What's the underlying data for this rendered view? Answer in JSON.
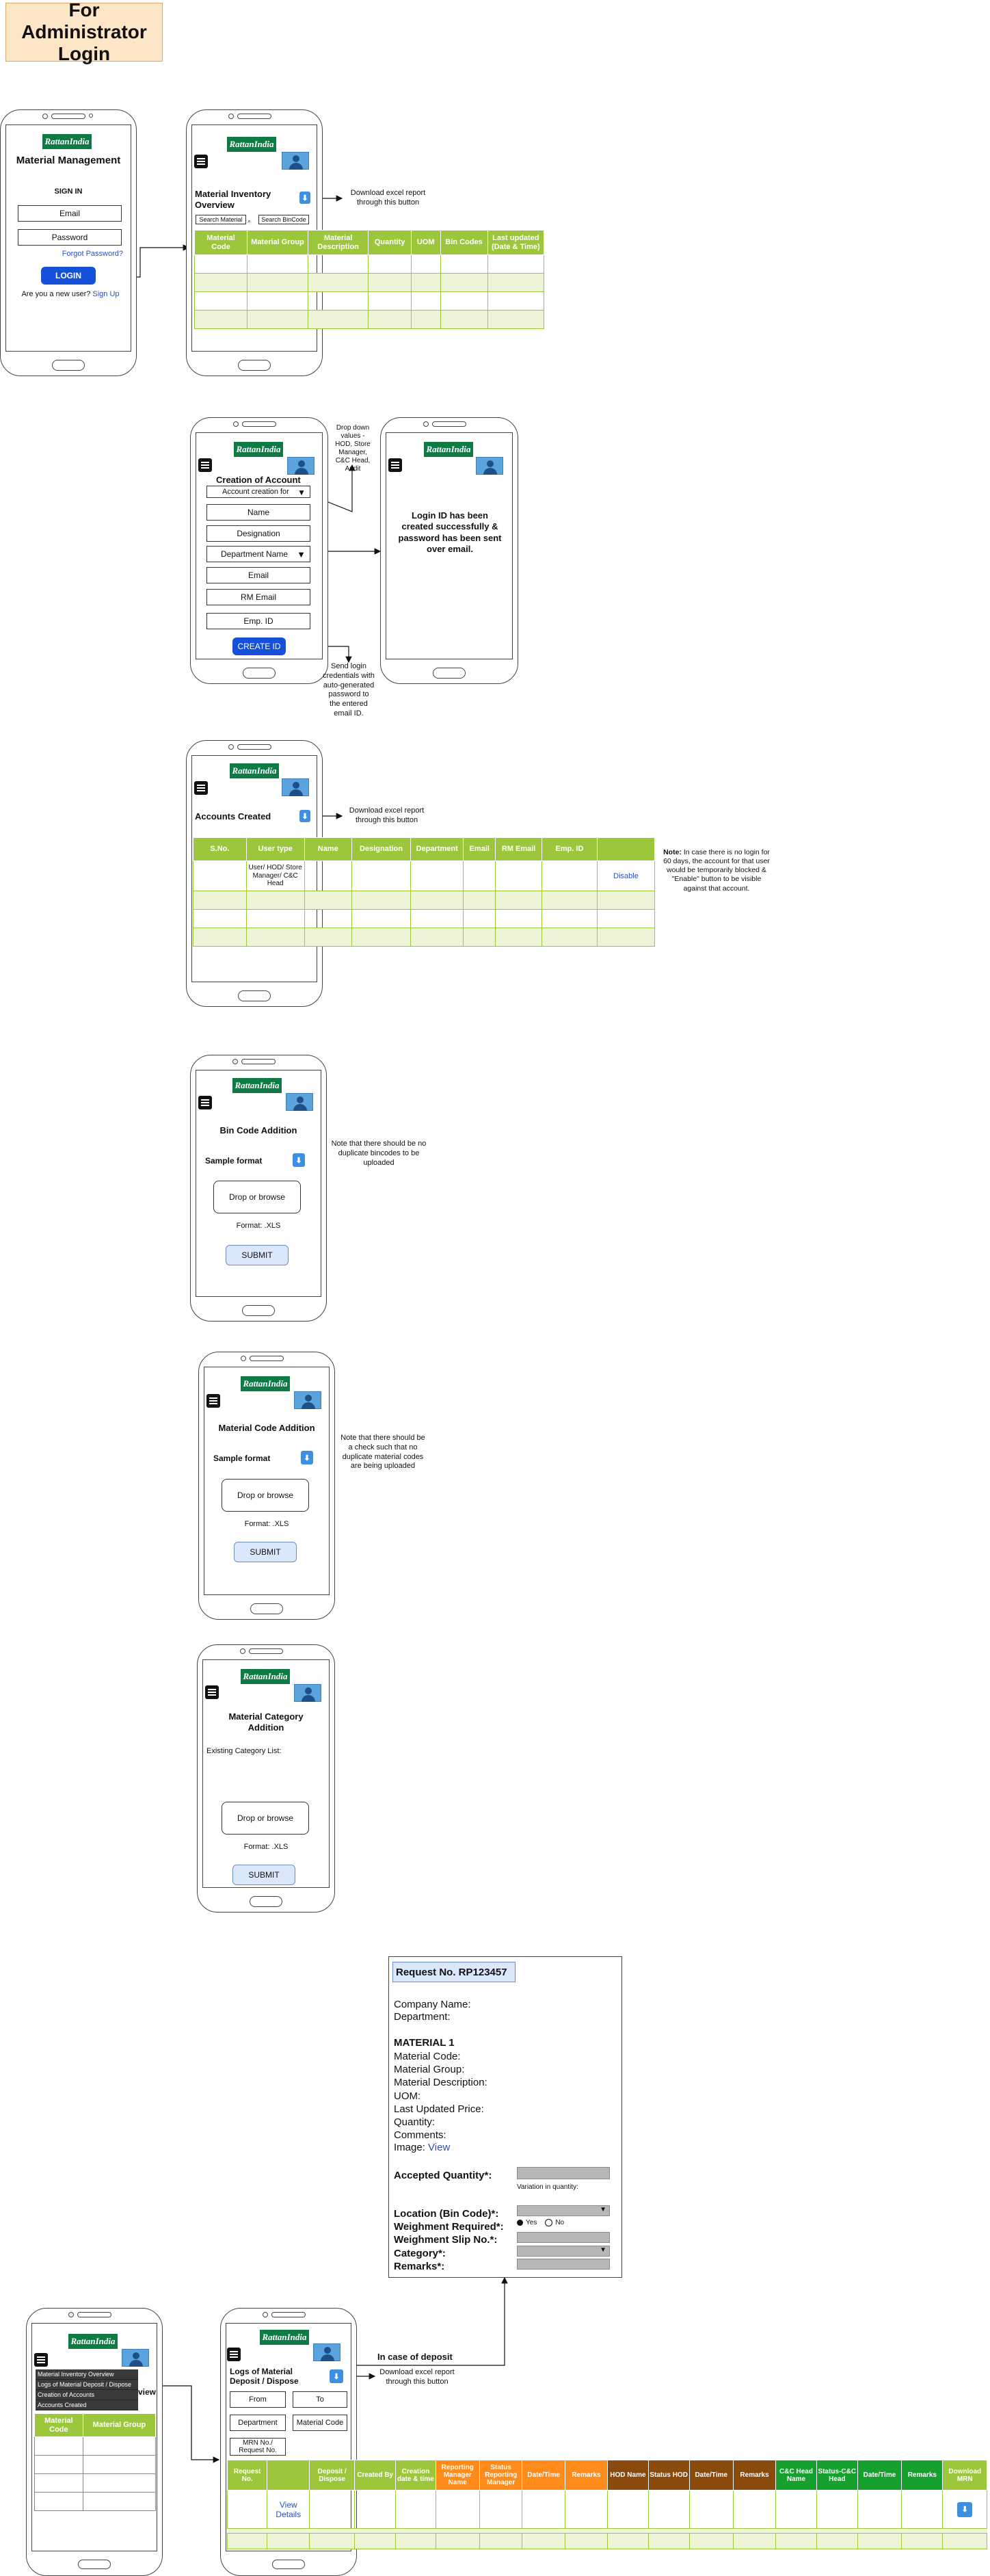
{
  "page": {
    "title": "For Administrator Login"
  },
  "app": {
    "logo_text": "RattanIndia"
  },
  "login": {
    "app_title": "Material Management",
    "sign_in": "SIGN IN",
    "email_placeholder": "Email",
    "password_placeholder": "Password",
    "forgot": "Forgot Password?",
    "login_button": "LOGIN",
    "new_user": "Are you a new user?",
    "signup": "Sign Up"
  },
  "inventory": {
    "title": "Material Inventory Overview",
    "search_material": "Search Material",
    "search_bincode": "Search BinCode",
    "note": "Download excel report through this button",
    "columns": [
      "Material Code",
      "Material Group",
      "Material Description",
      "Quantity",
      "UOM",
      "Bin Codes",
      "Last updated (Date & Time)"
    ]
  },
  "create_account": {
    "title": "Creation of Account",
    "account_for": "Account creation for",
    "name": "Name",
    "designation": "Designation",
    "department": "Department Name",
    "email": "Email",
    "rm_email": "RM Email",
    "emp_id": "Emp. ID",
    "create_button": "CREATE ID",
    "dropdown_note": "Drop down values - HOD, Store Manager, C&C Head, Audit",
    "credentials_note": "Send login credentials with auto-generated password to the entered email ID."
  },
  "created_msg": {
    "text": "Login ID has been created successfully & password has been sent over email."
  },
  "accounts": {
    "title": "Accounts Created",
    "note": "Download excel report through this button",
    "columns": [
      "S.No.",
      "User type",
      "Name",
      "Designation",
      "Department",
      "Email",
      "RM Email",
      "Emp. ID",
      ""
    ],
    "row1_user_type": "User/ HOD/ Store Manager/ C&C Head",
    "row1_action": "Disable",
    "side_note_label": "Note:",
    "side_note": "In case there is no login for 60 days, the account for that user would be temporarily blocked & \"Enable\" button to be visible against that account."
  },
  "bincode": {
    "title": "Bin Code Addition",
    "sample": "Sample format",
    "drop": "Drop or browse",
    "format": "Format: .XLS",
    "submit": "SUBMIT",
    "note": "Note that there should be no duplicate bincodes to be uploaded"
  },
  "matcode": {
    "title": "Material Code Addition",
    "sample": "Sample format",
    "drop": "Drop or browse",
    "format": "Format: .XLS",
    "submit": "SUBMIT",
    "note": "Note that there should be a check such that no duplicate material codes are being uploaded"
  },
  "category": {
    "title": "Material Category Addition",
    "existing": "Existing Category List:",
    "drop": "Drop or browse",
    "format": "Format: .XLS",
    "submit": "SUBMIT"
  },
  "request": {
    "title": "Request No. RP123457",
    "company": "Company Name:",
    "department": "Department:",
    "material": "MATERIAL 1",
    "fields": [
      "Material Code:",
      "Material Group:",
      "Material Description:",
      "UOM:",
      "Last Updated Price:",
      "Quantity:",
      "Comments:"
    ],
    "image_label": "Image:",
    "image_link": "View",
    "accepted_qty": "Accepted Quantity*:",
    "variation": "Variation in quantity:",
    "location": "Location (Bin Code)*:",
    "weighment_required": "Weighment Required*:",
    "yes": "Yes",
    "no": "No",
    "weighment_slip": "Weighment Slip No.*:",
    "category": "Category*:",
    "remarks": "Remarks*:"
  },
  "menu_phone": {
    "items": [
      "Material Inventory Overview",
      "Logs of Material Deposit / Dispose",
      "Creation of Accounts",
      "Accounts Created"
    ],
    "overflow": "view",
    "columns": [
      "Material Code",
      "Material Group"
    ]
  },
  "logs": {
    "title": "Logs of Material Deposit / Dispose",
    "from": "From",
    "to": "To",
    "department": "Department",
    "material_code": "Material Code",
    "mrn": "MRN No./ Request No.",
    "deposit_note": "In case of deposit",
    "download_note": "Download excel report through this button",
    "view_details": "View Details",
    "columns": [
      {
        "label": "Request No.",
        "color": "g"
      },
      {
        "label": "",
        "color": "g"
      },
      {
        "label": "Deposit / Dispose",
        "color": "g"
      },
      {
        "label": "Created By",
        "color": "g"
      },
      {
        "label": "Creation date & time",
        "color": "g"
      },
      {
        "label": "Reporting Manager Name",
        "color": "o"
      },
      {
        "label": "Status Reporting Manager",
        "color": "o"
      },
      {
        "label": "Date/Time",
        "color": "o"
      },
      {
        "label": "Remarks",
        "color": "o"
      },
      {
        "label": "HOD Name",
        "color": "b"
      },
      {
        "label": "Status HOD",
        "color": "b"
      },
      {
        "label": "Date/Time",
        "color": "b"
      },
      {
        "label": "Remarks",
        "color": "b"
      },
      {
        "label": "C&C Head Name",
        "color": "dg"
      },
      {
        "label": "Status-C&C Head",
        "color": "dg"
      },
      {
        "label": "Date/Time",
        "color": "dg"
      },
      {
        "label": "Remarks",
        "color": "dg"
      },
      {
        "label": "Download MRN",
        "color": "g"
      }
    ]
  }
}
